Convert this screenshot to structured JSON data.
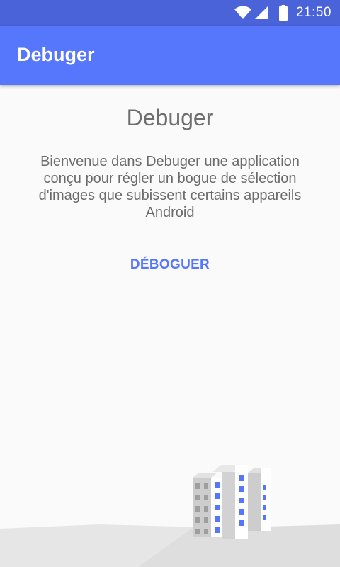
{
  "status_bar": {
    "time": "21:50",
    "icons": [
      "wifi-icon",
      "signal-icon",
      "battery-icon"
    ]
  },
  "app_bar": {
    "title": "Debuger"
  },
  "main": {
    "title": "Debuger",
    "description": "Bienvenue dans Debuger une application conçu pour régler un bogue de sélection d'images que subissent certains appareils Android",
    "button_label": "DÉBOGUER"
  },
  "colors": {
    "primary": "#5677fc",
    "primary_dark": "#4a63d8",
    "background": "#fafafa",
    "text": "#6e6e6e"
  }
}
